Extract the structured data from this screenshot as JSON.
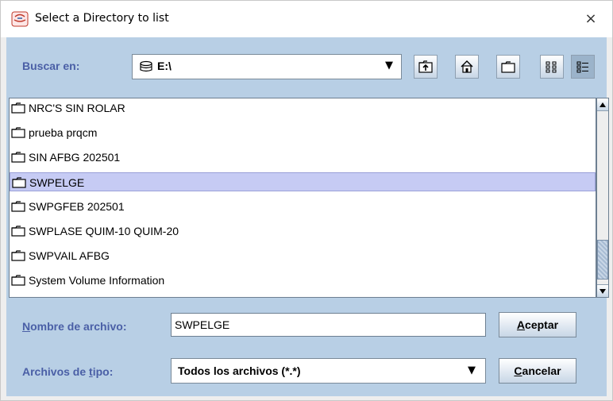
{
  "window": {
    "title": "Select a Directory to list",
    "close_glyph": "×"
  },
  "lookin": {
    "label": "Buscar en:",
    "value": "E:\\",
    "drive_icon": "drive-icon",
    "arrow": "▼"
  },
  "toolbar": [
    "up-folder-icon",
    "home-icon",
    "new-folder-icon",
    "list-view-icon",
    "details-view-icon"
  ],
  "files": [
    {
      "name": "NRC'S SIN ROLAR",
      "selected": false
    },
    {
      "name": "prueba prqcm",
      "selected": false
    },
    {
      "name": "SIN AFBG 202501",
      "selected": false
    },
    {
      "name": "SWPELGE",
      "selected": true
    },
    {
      "name": "SWPGFEB 202501",
      "selected": false
    },
    {
      "name": "SWPLASE QUIM-10 QUIM-20",
      "selected": false
    },
    {
      "name": "SWPVAIL AFBG",
      "selected": false
    },
    {
      "name": "System Volume Information",
      "selected": false
    }
  ],
  "filename": {
    "label_u": "N",
    "label_rest": "ombre de archivo:",
    "value": "SWPELGE"
  },
  "filetype": {
    "label_pre": "Archivos de ",
    "label_u": "t",
    "label_post": "ipo:",
    "value": "Todos los archivos (*.*)",
    "arrow": "▼"
  },
  "buttons": {
    "accept_u": "A",
    "accept_rest": "ceptar",
    "cancel_u": "C",
    "cancel_rest": "ancelar"
  },
  "colors": {
    "panel": "#b8cfe5",
    "label": "#4a5fa6",
    "selection": "#c6cbf4"
  }
}
